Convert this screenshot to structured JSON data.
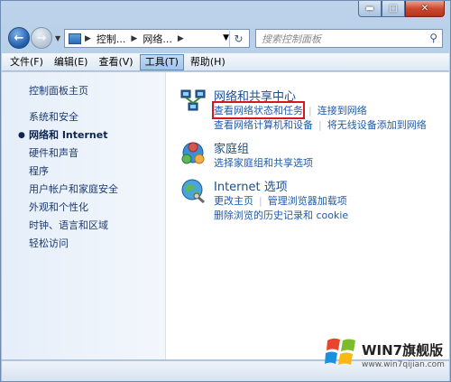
{
  "window": {
    "controls": {
      "minimize": "▬",
      "maximize": "□",
      "close": "✕"
    }
  },
  "address": {
    "crumbs": [
      "控制...",
      "网络..."
    ],
    "search_placeholder": "搜索控制面板"
  },
  "menu": [
    {
      "label": "文件(F)"
    },
    {
      "label": "编辑(E)"
    },
    {
      "label": "查看(V)"
    },
    {
      "label": "工具(T)"
    },
    {
      "label": "帮助(H)"
    }
  ],
  "sidebar": {
    "home": "控制面板主页",
    "items": [
      {
        "label": "系统和安全"
      },
      {
        "label": "网络和 Internet"
      },
      {
        "label": "硬件和声音"
      },
      {
        "label": "程序"
      },
      {
        "label": "用户帐户和家庭安全"
      },
      {
        "label": "外观和个性化"
      },
      {
        "label": "时钟、语言和区域"
      },
      {
        "label": "轻松访问"
      }
    ]
  },
  "sections": {
    "network": {
      "title": "网络和共享中心",
      "links": [
        "查看网络状态和任务",
        "连接到网络",
        "查看网络计算机和设备",
        "将无线设备添加到网络"
      ]
    },
    "homegroup": {
      "title": "家庭组",
      "links": [
        "选择家庭组和共享选项"
      ]
    },
    "internet": {
      "title": "Internet 选项",
      "links": [
        "更改主页",
        "管理浏览器加载项",
        "删除浏览的历史记录和 cookie"
      ]
    }
  },
  "watermark": {
    "brand": "WIN7旗舰版",
    "url": "www.win7qijian.com"
  },
  "colors": {
    "link": "#1f5aab",
    "highlight": "#d4181e",
    "title": "#1a4f8e"
  }
}
